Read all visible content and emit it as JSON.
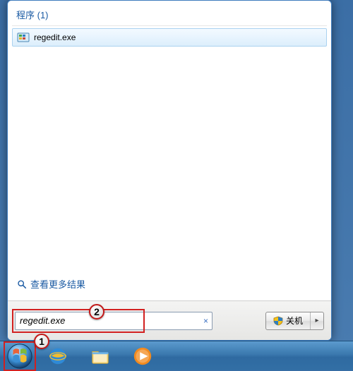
{
  "startmenu": {
    "category_header": "程序 (1)",
    "results": [
      {
        "label": "regedit.exe"
      }
    ],
    "see_more": "查看更多结果",
    "search_value": "regedit.exe",
    "clear_symbol": "×",
    "shutdown_label": "关机",
    "shutdown_arrow": "▸"
  },
  "callouts": {
    "start": "1",
    "search": "2"
  }
}
